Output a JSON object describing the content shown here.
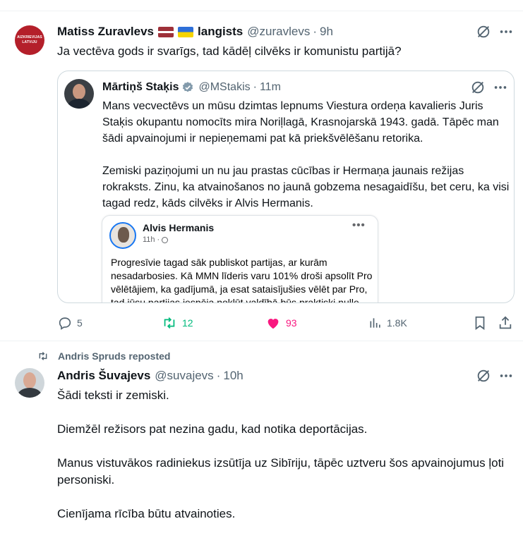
{
  "tweet1": {
    "avatar_text": [
      "AIZKRIEVIJAS",
      "LATVIJU"
    ],
    "author_name": "Matiss Zuravlevs",
    "author_name_suffix": "langists",
    "handle": "@zuravlevs",
    "time": "9h",
    "text": "Ja vectēva gods ir svarīgs, tad kādēļ cilvēks ir komunistu partijā?",
    "quote": {
      "author_name": "Mārtiņš Staķis",
      "handle": "@MStakis",
      "time": "11m",
      "paragraph1": "Mans vecvectēvs un mūsu dzimtas lepnums Viestura ordeņa kavalieris Juris Staķis okupantu nomocīts mira Noriļlagā, Krasnojarskā 1943. gadā. Tāpēc man šādi apvainojumi ir nepieņemami pat kā priekšvēlēšanu retorika.",
      "paragraph2": "Zemiski paziņojumi un nu jau prastas cūcības ir Hermaņa jaunais režijas rokraksts. Zinu, ka atvainošanos no jaunā gobzema nesagaidīšu, bet ceru, ka visi tagad redz, kāds cilvēks ir Alvis Hermanis.",
      "embed": {
        "name": "Alvis Hermanis",
        "time": "11h",
        "more": "•••",
        "text": "Progresīvie tagad sāk publiskot partijas, ar kurām nesadarbosies. Kā MMN līderis varu 101% droši apsolīt Pro vēlētājiem, ka gadījumā, ja esat sataisījušies vēlēt par Pro, tad jūsu partijas iespēja nokļūt valdībā būs praktiski nulle."
      }
    },
    "actions": {
      "replies": "5",
      "reposts": "12",
      "likes": "93",
      "views": "1.8K"
    }
  },
  "tweet2": {
    "repost_label": "Andris Spruds reposted",
    "author_name": "Andris Šuvajevs",
    "handle": "@suvajevs",
    "time": "10h",
    "paragraphs": [
      "Šādi teksti ir zemiski.",
      "Diemžēl režisors pat nezina gadu, kad notika deportācijas.",
      "Manus vistuvākos radiniekus izsūtīja uz Sibīriju, tāpēc uztveru šos apvainojumus ļoti personiski.",
      "Cienījama rīcība būtu atvainoties."
    ]
  },
  "colors": {
    "text": "#0f1419",
    "muted": "#536471",
    "repost_green": "#00ba7c",
    "like_pink": "#f91880",
    "verified_blue": "#829aab",
    "avatar_red": "#b41f2a"
  },
  "icons": {
    "grok": "grok-slash-circle-icon",
    "more": "more-dots-icon",
    "reply": "reply-bubble-icon",
    "repost": "repost-arrows-icon",
    "like": "heart-icon",
    "views": "analytics-bars-icon",
    "bookmark": "bookmark-icon",
    "share": "share-upload-icon"
  }
}
